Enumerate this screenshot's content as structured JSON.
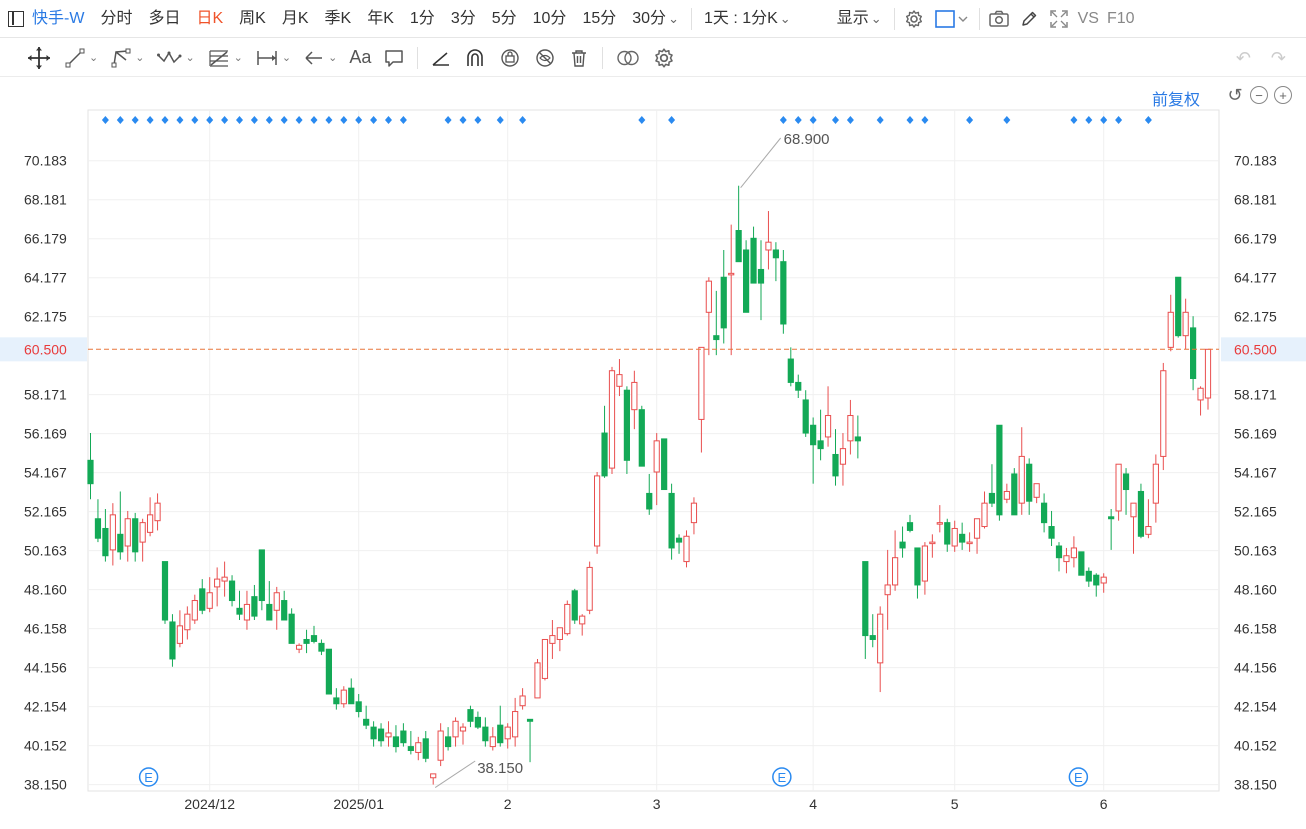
{
  "topbar": {
    "title": "快手-W",
    "periods": [
      "分时",
      "多日",
      "日K",
      "周K",
      "月K",
      "季K",
      "年K",
      "1分",
      "3分",
      "5分",
      "10分",
      "15分"
    ],
    "active_period": "日K",
    "more_minutes": "30分",
    "range": "1天 : 1分K",
    "display": "显示",
    "vs": "VS",
    "f10": "F10"
  },
  "chart_header": {
    "adjust": "前复权"
  },
  "colors": {
    "up": "#e94e4e",
    "down": "#13a956",
    "current": "#e8763a",
    "accent": "#2a7ae4"
  },
  "chart_data": {
    "type": "candlestick",
    "title": "",
    "ylim": [
      37.4,
      71.0
    ],
    "yticks": [
      "70.183",
      "68.181",
      "66.179",
      "64.177",
      "62.175",
      "58.171",
      "56.169",
      "54.167",
      "52.165",
      "50.163",
      "48.160",
      "46.158",
      "44.156",
      "42.154",
      "40.152",
      "38.150"
    ],
    "current_price": "60.500",
    "high_label": "68.900",
    "low_label": "38.150",
    "xticks": [
      {
        "label": "2024/12",
        "index": 8
      },
      {
        "label": "2025/01",
        "index": 18
      },
      {
        "label": "2",
        "index": 28
      },
      {
        "label": "3",
        "index": 38
      },
      {
        "label": "4",
        "index": 48.5
      },
      {
        "label": "5",
        "index": 58
      },
      {
        "label": "6",
        "index": 68
      }
    ],
    "event_marker": "E",
    "events": [
      3.9,
      46.4,
      66.3
    ],
    "signals": [
      1,
      2,
      3,
      4,
      5,
      6,
      7,
      8,
      9,
      10,
      11,
      12,
      13,
      14,
      15,
      16,
      17,
      18,
      19,
      20,
      21,
      24,
      25,
      26,
      27.5,
      29,
      37,
      39,
      46.5,
      47.5,
      48.5,
      50,
      51,
      53,
      55,
      56,
      59,
      61.5,
      66,
      67,
      68,
      69,
      71
    ],
    "candles": [
      [
        0,
        54.8,
        56.2,
        52.8,
        53.6
      ],
      [
        0.5,
        51.8,
        52.8,
        50.6,
        50.8
      ],
      [
        1,
        51.3,
        52.3,
        49.6,
        49.9
      ],
      [
        1.5,
        50.2,
        52.6,
        49.4,
        52.0
      ],
      [
        2,
        51.0,
        53.2,
        49.7,
        50.1
      ],
      [
        2.5,
        50.4,
        52.2,
        49.6,
        51.8
      ],
      [
        3,
        51.8,
        52.1,
        49.6,
        50.1
      ],
      [
        3.5,
        50.6,
        51.8,
        49.6,
        51.6
      ],
      [
        4,
        51.1,
        52.9,
        50.9,
        52.0
      ],
      [
        4.5,
        51.7,
        53.1,
        51.2,
        52.6
      ],
      [
        5,
        49.6,
        49.6,
        46.4,
        46.6
      ],
      [
        5.5,
        46.5,
        46.9,
        44.2,
        44.6
      ],
      [
        6,
        45.4,
        47.1,
        45.2,
        46.3
      ],
      [
        6.5,
        46.1,
        47.3,
        45.6,
        46.9
      ],
      [
        7,
        46.6,
        47.9,
        46.4,
        47.6
      ],
      [
        7.5,
        48.2,
        48.7,
        46.9,
        47.1
      ],
      [
        8,
        47.2,
        48.8,
        47.0,
        48.0
      ],
      [
        8.5,
        48.3,
        49.3,
        47.3,
        48.7
      ],
      [
        9,
        48.6,
        49.6,
        47.8,
        48.8
      ],
      [
        9.5,
        48.6,
        48.9,
        47.3,
        47.6
      ],
      [
        10,
        47.2,
        48.1,
        46.6,
        46.9
      ],
      [
        10.5,
        46.6,
        48.1,
        46.1,
        47.4
      ],
      [
        11,
        47.8,
        48.4,
        46.6,
        46.8
      ],
      [
        11.5,
        50.2,
        50.2,
        47.1,
        47.6
      ],
      [
        12,
        47.4,
        48.6,
        46.9,
        46.6
      ],
      [
        12.5,
        47.1,
        48.3,
        46.1,
        48.0
      ],
      [
        13,
        47.6,
        48.1,
        46.6,
        46.6
      ],
      [
        13.5,
        46.9,
        47.2,
        45.6,
        45.4
      ],
      [
        14,
        45.1,
        45.4,
        44.9,
        45.3
      ],
      [
        14.5,
        45.6,
        46.1,
        44.9,
        45.4
      ],
      [
        15,
        45.8,
        46.3,
        45.4,
        45.5
      ],
      [
        15.5,
        45.4,
        45.6,
        44.8,
        45.0
      ],
      [
        16,
        45.1,
        45.1,
        43.0,
        42.8
      ],
      [
        16.5,
        42.6,
        43.1,
        42.0,
        42.3
      ],
      [
        17,
        42.3,
        43.2,
        42.1,
        43.0
      ],
      [
        17.5,
        43.1,
        43.6,
        42.4,
        42.3
      ],
      [
        18,
        42.4,
        42.8,
        41.6,
        41.9
      ],
      [
        18.5,
        41.5,
        42.2,
        41.0,
        41.2
      ],
      [
        19,
        41.1,
        41.4,
        40.1,
        40.5
      ],
      [
        19.5,
        41.0,
        41.3,
        40.1,
        40.4
      ],
      [
        20,
        40.6,
        41.4,
        40.1,
        40.8
      ],
      [
        20.5,
        40.6,
        41.2,
        39.8,
        40.1
      ],
      [
        21,
        40.9,
        41.3,
        40.1,
        40.3
      ],
      [
        21.5,
        40.1,
        40.9,
        39.7,
        39.9
      ],
      [
        22,
        39.8,
        40.6,
        39.4,
        40.3
      ],
      [
        22.5,
        40.5,
        40.9,
        39.3,
        39.5
      ],
      [
        23,
        38.5,
        38.7,
        38.15,
        38.7
      ],
      [
        23.5,
        39.4,
        41.3,
        39.1,
        40.9
      ],
      [
        24,
        40.6,
        41.1,
        39.9,
        40.1
      ],
      [
        24.5,
        40.6,
        41.6,
        40.1,
        41.4
      ],
      [
        25,
        40.9,
        41.3,
        40.2,
        41.1
      ],
      [
        25.5,
        42.0,
        42.2,
        41.1,
        41.4
      ],
      [
        26,
        41.6,
        41.9,
        41.0,
        41.1
      ],
      [
        26.5,
        41.1,
        41.6,
        40.1,
        40.4
      ],
      [
        27,
        40.1,
        41.1,
        39.9,
        40.6
      ],
      [
        27.5,
        41.2,
        42.2,
        40.1,
        40.3
      ],
      [
        28,
        40.5,
        41.3,
        40.0,
        41.1
      ],
      [
        28.5,
        40.6,
        42.6,
        40.1,
        41.9
      ],
      [
        29,
        42.2,
        43.1,
        42.0,
        42.7
      ],
      [
        29.5,
        41.5,
        41.5,
        39.3,
        41.4
      ],
      [
        30,
        42.6,
        44.6,
        42.6,
        44.4
      ],
      [
        30.5,
        43.6,
        45.6,
        43.5,
        45.6
      ],
      [
        31,
        45.4,
        46.6,
        44.6,
        45.8
      ],
      [
        31.5,
        45.6,
        46.2,
        45.0,
        46.2
      ],
      [
        32,
        45.9,
        47.6,
        45.8,
        47.4
      ],
      [
        32.5,
        48.1,
        48.2,
        46.4,
        46.6
      ],
      [
        33,
        46.4,
        46.9,
        45.8,
        46.8
      ],
      [
        33.5,
        47.1,
        49.6,
        46.9,
        49.3
      ],
      [
        34,
        50.4,
        54.2,
        50.0,
        54.0
      ],
      [
        34.5,
        56.2,
        57.6,
        53.9,
        54.0
      ],
      [
        35,
        54.4,
        59.6,
        54.1,
        59.4
      ],
      [
        35.5,
        58.6,
        60.0,
        58.1,
        59.2
      ],
      [
        36,
        58.4,
        58.6,
        54.1,
        54.8
      ],
      [
        36.5,
        57.4,
        59.4,
        56.4,
        58.8
      ],
      [
        37,
        57.4,
        57.6,
        54.7,
        54.5
      ],
      [
        37.5,
        53.1,
        54.1,
        52.0,
        52.3
      ],
      [
        38,
        54.2,
        56.2,
        52.5,
        55.8
      ],
      [
        38.5,
        55.9,
        55.8,
        53.6,
        53.3
      ],
      [
        39,
        53.1,
        53.6,
        49.7,
        50.3
      ],
      [
        39.5,
        50.8,
        51.0,
        50.0,
        50.6
      ],
      [
        40,
        49.6,
        51.2,
        49.3,
        50.9
      ],
      [
        40.5,
        51.6,
        52.9,
        51.0,
        52.6
      ],
      [
        41,
        56.9,
        58.0,
        55.2,
        60.6
      ],
      [
        41.5,
        62.4,
        64.2,
        60.2,
        64.0
      ],
      [
        42,
        61.2,
        63.5,
        60.2,
        61.0
      ],
      [
        42.5,
        64.2,
        65.6,
        60.8,
        61.6
      ],
      [
        43,
        64.4,
        66.9,
        60.2,
        64.4
      ],
      [
        43.5,
        66.6,
        68.9,
        65.4,
        65.0
      ],
      [
        44,
        65.6,
        66.1,
        62.4,
        62.4
      ],
      [
        44.5,
        66.2,
        66.8,
        64.0,
        63.9
      ],
      [
        45,
        64.6,
        66.1,
        62.0,
        63.9
      ],
      [
        45.5,
        65.6,
        67.6,
        64.6,
        66.0
      ],
      [
        46,
        65.6,
        66.0,
        64.0,
        65.2
      ],
      [
        46.5,
        65.0,
        65.6,
        61.3,
        61.8
      ],
      [
        47,
        60.0,
        60.6,
        58.6,
        58.8
      ],
      [
        47.5,
        58.8,
        59.2,
        58.0,
        58.4
      ],
      [
        48,
        57.9,
        58.4,
        56.0,
        56.2
      ],
      [
        48.5,
        56.6,
        57.0,
        53.6,
        55.6
      ],
      [
        49,
        55.8,
        57.4,
        54.8,
        55.4
      ],
      [
        49.5,
        56.0,
        58.6,
        55.5,
        57.1
      ],
      [
        50,
        55.1,
        56.4,
        53.5,
        54.0
      ],
      [
        50.5,
        54.6,
        56.2,
        53.5,
        55.4
      ],
      [
        51,
        55.8,
        57.9,
        55.1,
        57.1
      ],
      [
        51.5,
        56.0,
        57.1,
        54.9,
        55.8
      ],
      [
        52,
        49.6,
        49.6,
        44.6,
        45.8
      ],
      [
        52.5,
        45.8,
        46.9,
        45.2,
        45.6
      ],
      [
        53,
        44.4,
        47.3,
        42.9,
        46.9
      ],
      [
        53.5,
        47.9,
        50.2,
        46.1,
        48.4
      ],
      [
        54,
        48.4,
        51.2,
        48.1,
        49.8
      ],
      [
        54.5,
        50.6,
        51.4,
        49.8,
        50.3
      ],
      [
        55,
        51.6,
        52.0,
        51.1,
        51.2
      ],
      [
        55.5,
        50.3,
        50.3,
        47.7,
        48.4
      ],
      [
        56,
        48.6,
        50.6,
        47.9,
        50.4
      ],
      [
        56.5,
        50.6,
        51.0,
        49.8,
        50.6
      ],
      [
        57,
        51.6,
        52.5,
        51.1,
        51.6
      ],
      [
        57.5,
        51.6,
        51.8,
        50.1,
        50.5
      ],
      [
        58,
        50.4,
        51.7,
        50.1,
        51.3
      ],
      [
        58.5,
        51.0,
        51.6,
        50.2,
        50.6
      ],
      [
        59,
        50.6,
        51.1,
        50.1,
        50.6
      ],
      [
        59.5,
        50.8,
        51.8,
        50.0,
        51.8
      ],
      [
        60,
        51.4,
        53.2,
        51.3,
        52.6
      ],
      [
        60.5,
        53.1,
        54.6,
        52.4,
        52.6
      ],
      [
        61,
        56.6,
        56.6,
        51.7,
        52.0
      ],
      [
        61.5,
        52.8,
        53.6,
        52.6,
        53.2
      ],
      [
        62,
        54.1,
        54.4,
        52.3,
        52.0
      ],
      [
        62.5,
        52.6,
        56.5,
        52.0,
        55.0
      ],
      [
        63,
        54.6,
        54.9,
        52.0,
        52.7
      ],
      [
        63.5,
        52.9,
        53.6,
        52.6,
        53.6
      ],
      [
        64,
        52.6,
        53.1,
        51.1,
        51.6
      ],
      [
        64.5,
        51.4,
        52.2,
        50.4,
        50.8
      ],
      [
        65,
        50.4,
        50.6,
        49.1,
        49.8
      ],
      [
        65.5,
        49.6,
        50.3,
        49.0,
        49.9
      ],
      [
        66,
        49.8,
        50.9,
        49.3,
        50.3
      ],
      [
        66.5,
        50.1,
        50.1,
        49.1,
        48.9
      ],
      [
        67,
        49.1,
        49.3,
        48.3,
        48.6
      ],
      [
        67.5,
        48.9,
        49.0,
        47.8,
        48.4
      ],
      [
        68,
        48.5,
        49.0,
        48.0,
        48.8
      ],
      [
        68.5,
        51.9,
        52.3,
        50.2,
        51.8
      ],
      [
        69,
        52.2,
        54.6,
        51.7,
        54.6
      ],
      [
        69.5,
        54.1,
        54.4,
        52.0,
        53.3
      ],
      [
        70,
        51.9,
        52.6,
        50.0,
        52.6
      ],
      [
        70.5,
        53.2,
        53.6,
        50.8,
        50.9
      ],
      [
        71,
        51.0,
        52.8,
        50.8,
        51.4
      ],
      [
        71.5,
        52.6,
        55.1,
        51.6,
        54.6
      ],
      [
        72,
        55.0,
        59.8,
        54.3,
        59.4
      ],
      [
        72.5,
        60.6,
        63.3,
        60.4,
        62.4
      ],
      [
        73,
        64.2,
        64.2,
        61.1,
        61.2
      ],
      [
        73.5,
        61.2,
        63.1,
        60.5,
        62.4
      ],
      [
        74,
        61.6,
        62.2,
        58.4,
        59.0
      ],
      [
        74.5,
        57.9,
        58.6,
        57.1,
        58.5
      ],
      [
        75,
        58.0,
        60.5,
        57.4,
        60.5
      ]
    ]
  }
}
